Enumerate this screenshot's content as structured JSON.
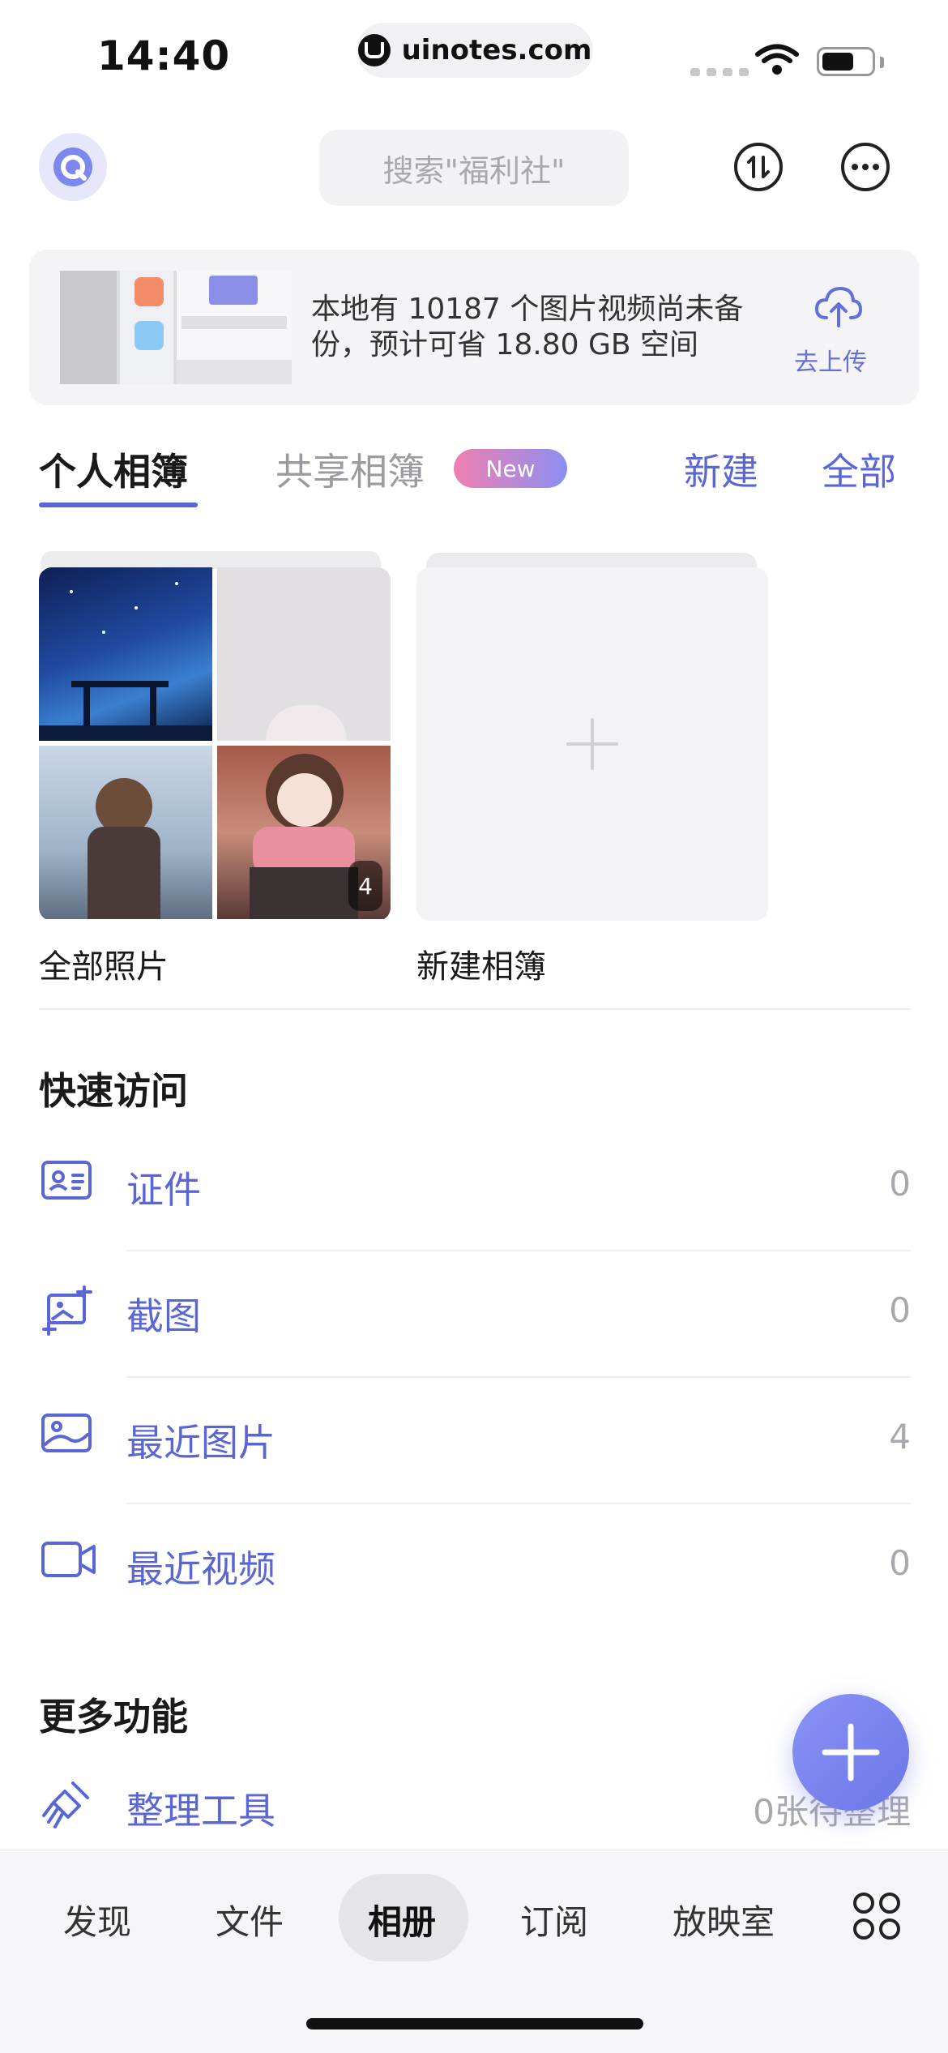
{
  "status_bar": {
    "time": "14:40",
    "url": "uinotes.com"
  },
  "header": {
    "search_placeholder": "搜索\"福利社\""
  },
  "backup_banner": {
    "message": "本地有 10187 个图片视频尚未备份，预计可省 18.80 GB 空间",
    "upload_label": "去上传"
  },
  "tabs": {
    "personal": "个人相簿",
    "shared": "共享相簿",
    "new_badge": "New",
    "create": "新建",
    "all": "全部"
  },
  "albums": [
    {
      "name": "全部照片",
      "count": "4"
    },
    {
      "name": "新建相簿"
    }
  ],
  "quick_access": {
    "title": "快速访问",
    "items": [
      {
        "label": "证件",
        "count": "0",
        "icon": "id-card-icon"
      },
      {
        "label": "截图",
        "count": "0",
        "icon": "screenshot-icon"
      },
      {
        "label": "最近图片",
        "count": "4",
        "icon": "image-icon"
      },
      {
        "label": "最近视频",
        "count": "0",
        "icon": "video-icon"
      }
    ]
  },
  "more_features": {
    "title": "更多功能",
    "items": [
      {
        "label": "整理工具",
        "status": "0张待整理",
        "icon": "broom-icon"
      }
    ]
  },
  "bottom_nav": {
    "items": [
      "发现",
      "文件",
      "相册",
      "订阅",
      "放映室"
    ],
    "active": "相册"
  },
  "colors": {
    "accent": "#5a66d6",
    "fab": "#7a84f0"
  }
}
